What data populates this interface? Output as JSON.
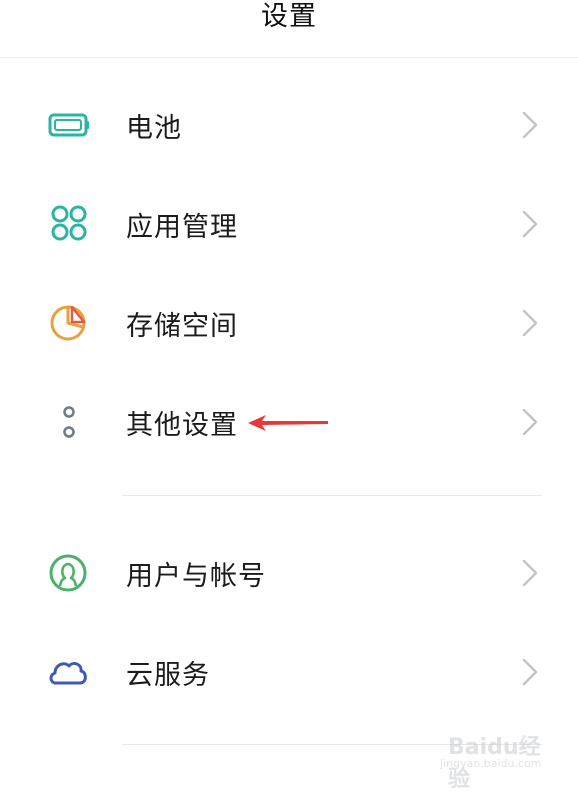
{
  "header": {
    "title": "设置"
  },
  "items": [
    {
      "label": "电池",
      "icon": "battery-icon"
    },
    {
      "label": "应用管理",
      "icon": "app-grid-icon"
    },
    {
      "label": "存储空间",
      "icon": "storage-pie-icon"
    },
    {
      "label": "其他设置",
      "icon": "more-dots-icon"
    },
    {
      "label": "用户与帐号",
      "icon": "user-account-icon"
    },
    {
      "label": "云服务",
      "icon": "cloud-icon"
    }
  ],
  "watermark": {
    "brand": "Baidu经验",
    "site": "jingyan.baidu.com"
  },
  "colors": {
    "teal": "#2bb3a3",
    "orange": "#e9a23b",
    "red_arrow": "#e53935",
    "green": "#4caf6a",
    "blue": "#3d5bb3",
    "gray_icon": "#6f7b86",
    "chevron": "#c4c4c4"
  }
}
